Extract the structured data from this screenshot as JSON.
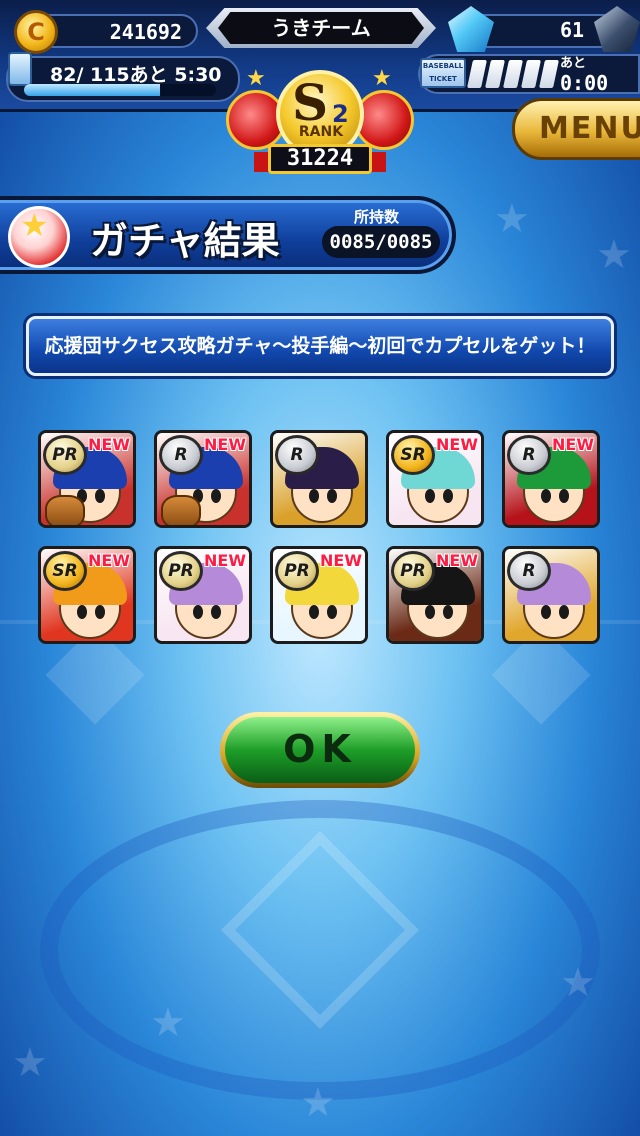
{
  "status": {
    "coins": "241692",
    "coin_symbol": "C",
    "team_name": "うきチーム",
    "gems": "61",
    "stamina_text": "82/ 115あと 5:30",
    "stamina_level": 0.71,
    "ticket_label": "BASEBALL TICKET",
    "ticket_ato": "あと",
    "ticket_time": "0:00",
    "ticket_filled": 5,
    "ticket_total": 5
  },
  "rank": {
    "letter": "S",
    "number": "2",
    "label": "RANK",
    "score": "31224"
  },
  "menu_label": "MENU",
  "title": {
    "text": "ガチャ結果",
    "owned_label": "所持数",
    "owned_value": "0085/0085"
  },
  "banner_text": "応援団サクセス攻略ガチャ～投手編～初回でカプセルをゲット！",
  "results": [
    {
      "rarity": "PR",
      "is_new": true,
      "new_label": "NEW",
      "bg": "#c9312c",
      "hair": "#1c3fb0"
    },
    {
      "rarity": "R",
      "is_new": true,
      "new_label": "NEW",
      "bg": "#c9312c",
      "hair": "#1c3fb0"
    },
    {
      "rarity": "R",
      "is_new": false,
      "new_label": "",
      "bg": "#d9a12a",
      "hair": "#2a1e48"
    },
    {
      "rarity": "SR",
      "is_new": true,
      "new_label": "NEW",
      "bg": "#f7e6f2",
      "hair": "#6fd8d4"
    },
    {
      "rarity": "R",
      "is_new": true,
      "new_label": "NEW",
      "bg": "#b5121a",
      "hair": "#1d9a3a"
    },
    {
      "rarity": "SR",
      "is_new": true,
      "new_label": "NEW",
      "bg": "#e0351f",
      "hair": "#f29a1a"
    },
    {
      "rarity": "PR",
      "is_new": true,
      "new_label": "NEW",
      "bg": "#f8e6f2",
      "hair": "#b58ad8"
    },
    {
      "rarity": "PR",
      "is_new": true,
      "new_label": "NEW",
      "bg": "#e7f6ff",
      "hair": "#f2d83a"
    },
    {
      "rarity": "PR",
      "is_new": true,
      "new_label": "NEW",
      "bg": "#6a2a16",
      "hair": "#151515"
    },
    {
      "rarity": "R",
      "is_new": false,
      "new_label": "",
      "bg": "#e1a62c",
      "hair": "#b58ad8"
    }
  ],
  "ok_label": "OK",
  "icons": {
    "coin": "coin-icon",
    "gem": "gem-icon",
    "stamina": "battery-icon",
    "ticket": "ticket-icon",
    "capsule": "capsule-icon"
  },
  "colors": {
    "accent_blue": "#1148ad",
    "gold": "#f5c92c",
    "new_red": "#ff1c44",
    "ok_green": "#1e9e28"
  }
}
